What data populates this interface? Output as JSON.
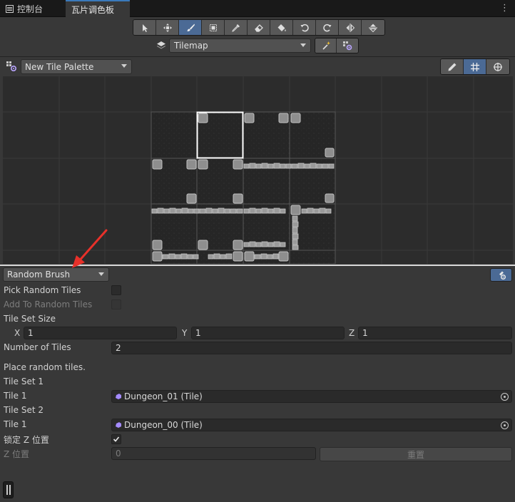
{
  "tabs": [
    {
      "label": "控制台",
      "icon": "console-icon"
    },
    {
      "label": "瓦片调色板",
      "icon": ""
    }
  ],
  "tools": [
    {
      "name": "select-tool",
      "icon": "arrow-cursor-icon"
    },
    {
      "name": "move-tool",
      "icon": "move-icon"
    },
    {
      "name": "paint-tool",
      "icon": "brush-icon",
      "active": true
    },
    {
      "name": "box-fill-tool",
      "icon": "box-fill-icon"
    },
    {
      "name": "picker-tool",
      "icon": "eyedropper-icon"
    },
    {
      "name": "erase-tool",
      "icon": "eraser-icon"
    },
    {
      "name": "fill-tool",
      "icon": "paint-bucket-icon"
    },
    {
      "name": "rotate-ccw-tool",
      "icon": "rotate-left-icon"
    },
    {
      "name": "rotate-cw-tool",
      "icon": "rotate-right-icon"
    },
    {
      "name": "flip-x-tool",
      "icon": "flip-horizontal-icon"
    },
    {
      "name": "flip-y-tool",
      "icon": "flip-vertical-icon"
    }
  ],
  "tilemap": {
    "selected": "Tilemap"
  },
  "palette": {
    "selected": "New Tile Palette"
  },
  "brush": {
    "selected": "Random Brush",
    "pick_random_tiles": "Pick Random Tiles",
    "add_to_random_tiles": "Add To Random Tiles",
    "tile_set_size": "Tile Set Size",
    "x_label": "X",
    "x_value": "1",
    "y_label": "Y",
    "y_value": "1",
    "z_label": "Z",
    "z_value": "1",
    "number_of_tiles_label": "Number of Tiles",
    "number_of_tiles_value": "2",
    "info": "Place random tiles.",
    "tile_sets": [
      {
        "title": "Tile Set 1",
        "tile_label": "Tile 1",
        "tile_value": "Dungeon_01 (Tile)"
      },
      {
        "title": "Tile Set 2",
        "tile_label": "Tile 1",
        "tile_value": "Dungeon_00 (Tile)"
      }
    ],
    "lock_z_label": "锁定 Z 位置",
    "lock_z_checked": true,
    "z_position_label": "Z 位置",
    "z_position_value": "0",
    "reset_label": "重置"
  },
  "colors": {
    "accent": "#4b6a95",
    "tab_highlight": "#3a79bb",
    "annotation_arrow": "#e8312a"
  }
}
